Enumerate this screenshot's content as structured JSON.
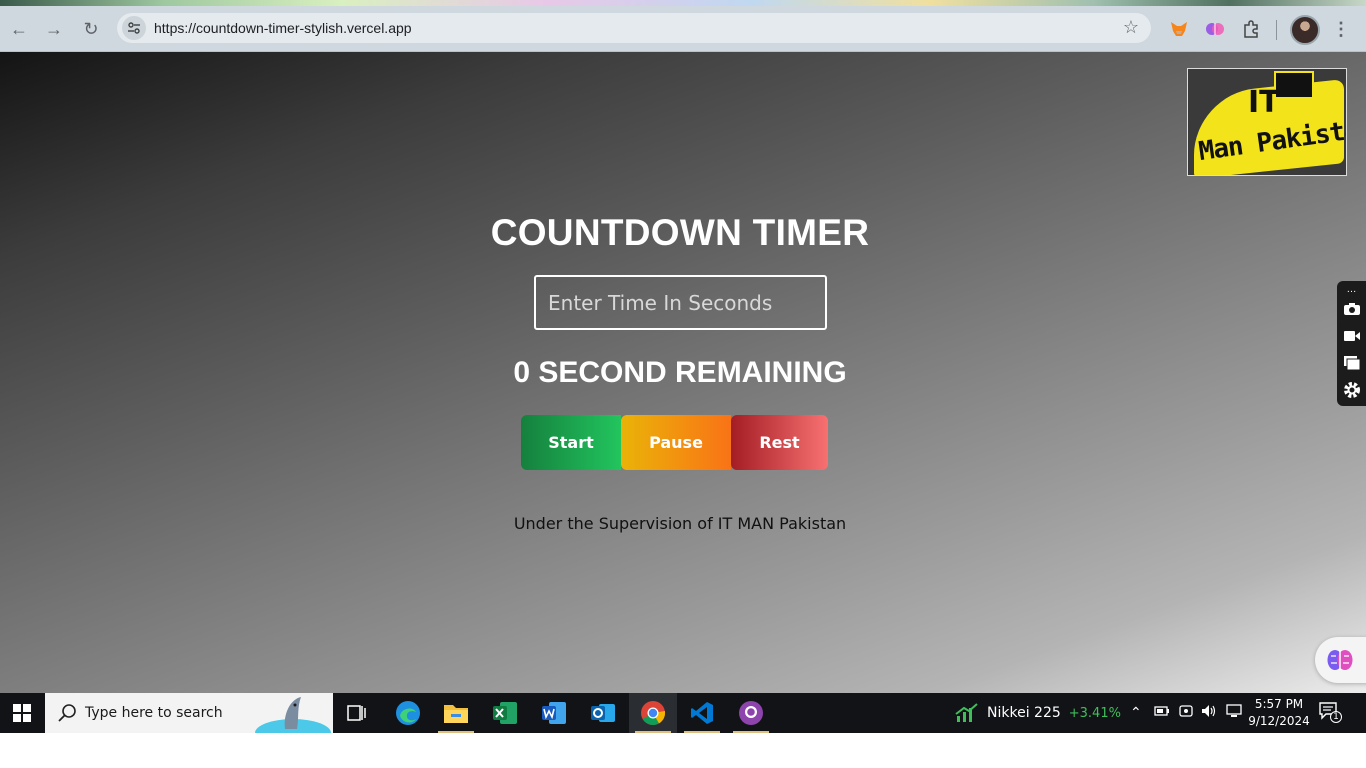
{
  "browser": {
    "url": "https://countdown-timer-stylish.vercel.app"
  },
  "page": {
    "logo_text_1": "IT",
    "logo_text_2": "Man Pakistan",
    "title": "COUNTDOWN TIMER",
    "input_placeholder": "Enter Time In Seconds",
    "input_value": "",
    "remaining": "0 SECOND REMAINING",
    "buttons": {
      "start": "Start",
      "pause": "Pause",
      "reset": "Rest"
    },
    "footer": "Under the Supervision of IT MAN Pakistan"
  },
  "taskbar": {
    "search_placeholder": "Type here to search",
    "apps": [
      "task-view",
      "edge",
      "file-explorer",
      "excel",
      "word",
      "outlook",
      "chrome",
      "vscode",
      "github-desktop"
    ],
    "ticker": {
      "name": "Nikkei 225",
      "change": "+3.41%"
    },
    "clock": {
      "time": "5:57 PM",
      "date": "9/12/2024"
    },
    "notification_count": "1"
  },
  "colors": {
    "start": "#22c55e",
    "pause": "#f97316",
    "reset": "#ef4444",
    "logo_yellow": "#f2e31a"
  }
}
